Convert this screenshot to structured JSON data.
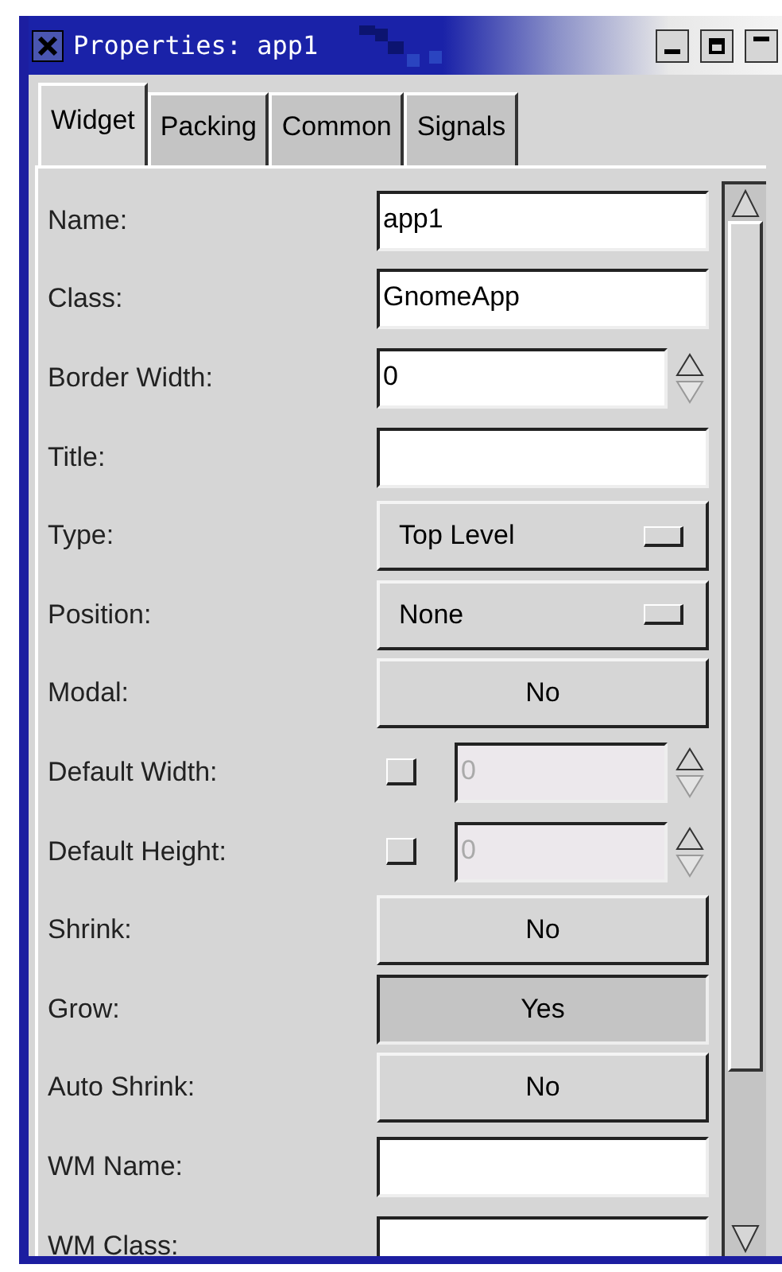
{
  "window": {
    "title": "Properties: app1"
  },
  "tabs": [
    {
      "label": "Widget",
      "selected": true
    },
    {
      "label": "Packing",
      "selected": false
    },
    {
      "label": "Common",
      "selected": false
    },
    {
      "label": "Signals",
      "selected": false
    }
  ],
  "rows": [
    {
      "kind": "text",
      "label": "Name:",
      "value": "app1"
    },
    {
      "kind": "text",
      "label": "Class:",
      "value": "GnomeApp"
    },
    {
      "kind": "spin",
      "label": "Border Width:",
      "value": "0"
    },
    {
      "kind": "text",
      "label": "Title:"
    },
    {
      "kind": "option",
      "label": "Type:",
      "value": "Top Level"
    },
    {
      "kind": "option",
      "label": "Position:",
      "value": "None"
    },
    {
      "kind": "toggle",
      "label": "Modal:",
      "value": "No",
      "on": false
    },
    {
      "kind": "check-spin",
      "label": "Default Width:",
      "value": "0",
      "checked": false,
      "disabled": true
    },
    {
      "kind": "check-spin",
      "label": "Default Height:",
      "value": "0",
      "checked": false,
      "disabled": true
    },
    {
      "kind": "toggle",
      "label": "Shrink:",
      "value": "No",
      "on": false
    },
    {
      "kind": "toggle",
      "label": "Grow:",
      "value": "Yes",
      "on": true
    },
    {
      "kind": "toggle",
      "label": "Auto Shrink:",
      "value": "No",
      "on": false
    },
    {
      "kind": "text",
      "label": "WM Name:"
    },
    {
      "kind": "text",
      "label": "WM Class:"
    }
  ]
}
